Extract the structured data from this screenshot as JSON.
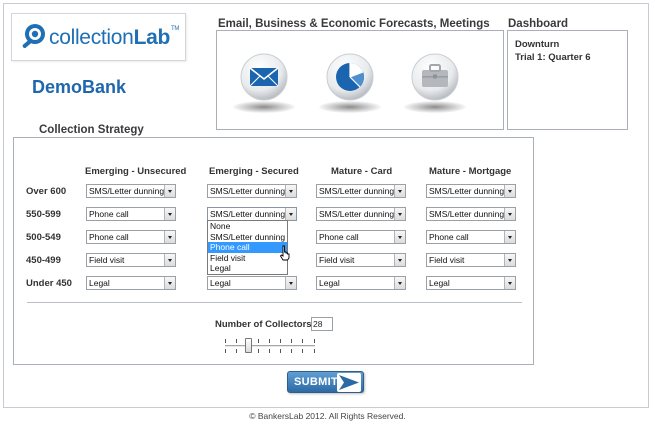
{
  "logo": {
    "text_main": "collection",
    "text_bold": "Lab",
    "trademark": "TM",
    "icon": "magnifier-coin-icon"
  },
  "bank_name": "DemoBank",
  "forecast": {
    "title": "Email, Business & Economic Forecasts, Meetings",
    "icons": [
      "envelope-icon",
      "pie-chart-icon",
      "briefcase-icon"
    ]
  },
  "dashboard": {
    "title": "Dashboard",
    "lines": [
      "Downturn",
      "Trial 1: Quarter 6"
    ]
  },
  "strategy": {
    "title": "Collection Strategy",
    "columns": [
      "Emerging - Unsecured",
      "Emerging - Secured",
      "Mature - Card",
      "Mature - Mortgage"
    ],
    "rows": [
      {
        "label": "Over 600",
        "values": [
          "SMS/Letter dunning",
          "SMS/Letter dunning",
          "SMS/Letter dunning",
          "SMS/Letter dunning"
        ]
      },
      {
        "label": "550-599",
        "values": [
          "Phone call",
          "SMS/Letter dunning",
          "SMS/Letter dunning",
          "SMS/Letter dunning"
        ]
      },
      {
        "label": "500-549",
        "values": [
          "Phone call",
          "",
          "Phone call",
          "Phone call"
        ]
      },
      {
        "label": "450-499",
        "values": [
          "Field visit",
          "",
          "Field visit",
          "Field visit"
        ]
      },
      {
        "label": "Under 450",
        "values": [
          "Legal",
          "Legal",
          "Legal",
          "Legal"
        ]
      }
    ],
    "open_dropdown": {
      "options": [
        "None",
        "SMS/Letter dunning",
        "Phone call",
        "Field visit",
        "Legal"
      ],
      "highlighted": "Phone call"
    }
  },
  "collectors": {
    "label": "Number of Collectors",
    "value": "28"
  },
  "submit": {
    "label": "SUBMIT",
    "icon": "arrow-right-icon"
  },
  "footer": "© BankersLab 2012. All Rights Reserved.",
  "colors": {
    "brand_blue": "#1e66ae",
    "orb_blue": "#1a64b0",
    "highlight": "#3399ff",
    "submit_blue": "#2c6aa6"
  }
}
